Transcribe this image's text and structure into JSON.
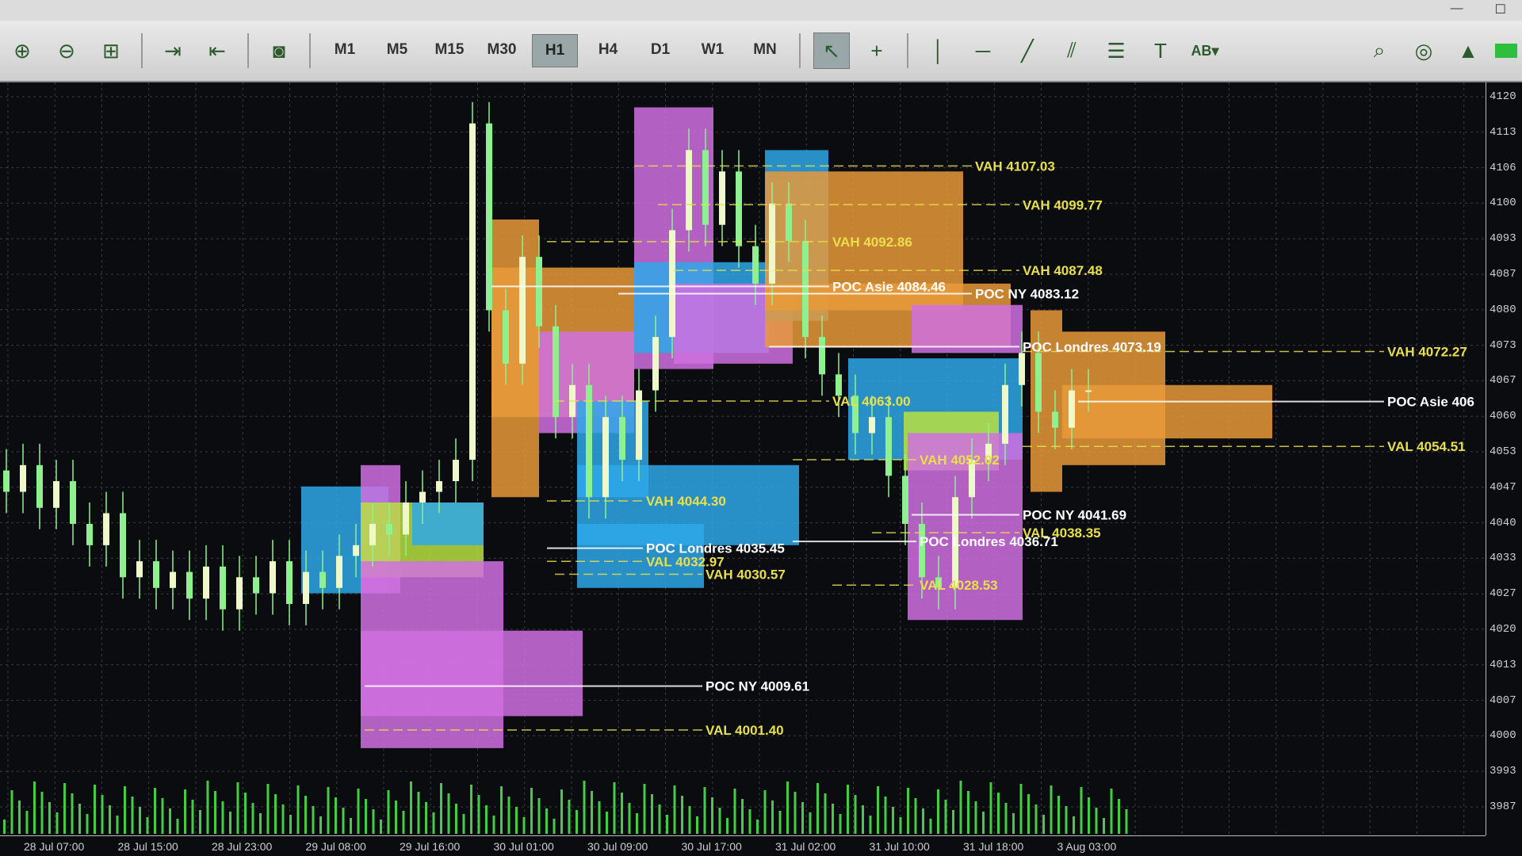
{
  "toolbar": {
    "icons": [
      "zoom-in-icon",
      "zoom-out-icon",
      "grid-icon",
      "autoscroll-icon",
      "chart-shift-icon",
      "screenshot-icon"
    ],
    "timeframes": [
      "M1",
      "M5",
      "M15",
      "M30",
      "H1",
      "H4",
      "D1",
      "W1",
      "MN"
    ],
    "active_timeframe": "H1",
    "tools": [
      "cursor-icon",
      "crosshair-icon",
      "vertical-line-icon",
      "horizontal-line-icon",
      "trendline-icon",
      "channel-icon",
      "fibonacci-icon",
      "text-icon",
      "shapes-icon"
    ],
    "right_icons": [
      "search-icon",
      "profile-icon",
      "signal-icon"
    ],
    "text_tool_glyph": "T",
    "shapes_glyph": "AB"
  },
  "price_axis": [
    "4120",
    "4113",
    "4106",
    "4100",
    "4093",
    "4087",
    "4080",
    "4073",
    "4067",
    "4060",
    "4053",
    "4047",
    "4040",
    "4033",
    "4027",
    "4020",
    "4013",
    "4007",
    "4000",
    "3993",
    "3987"
  ],
  "time_axis": [
    "28 Jul 07:00",
    "28 Jul 15:00",
    "28 Jul 23:00",
    "29 Jul 08:00",
    "29 Jul 16:00",
    "30 Jul 01:00",
    "30 Jul 09:00",
    "30 Jul 17:00",
    "31 Jul 02:00",
    "31 Jul 10:00",
    "31 Jul 18:00",
    "3 Aug 03:00"
  ],
  "levels": [
    {
      "text": "VAH 4107.03",
      "price": 4107.03
    },
    {
      "text": "VAH 4099.77",
      "price": 4099.77
    },
    {
      "text": "VAH 4092.86",
      "price": 4092.86
    },
    {
      "text": "VAH 4087.48",
      "price": 4087.48
    },
    {
      "text": "POC Asie 4084.46",
      "price": 4084.46
    },
    {
      "text": "POC NY 4083.12",
      "price": 4083.12
    },
    {
      "text": "VAH 4072.27",
      "price": 4072.27
    },
    {
      "text": "POC Londres 4073.19",
      "price": 4073.19
    },
    {
      "text": "VAL 4063.00",
      "price": 4063.0
    },
    {
      "text": "POC Asie 406",
      "price": 4062.9
    },
    {
      "text": "VAL 4054.51",
      "price": 4054.51
    },
    {
      "text": "VAH 4052.02",
      "price": 4052.02
    },
    {
      "text": "VAH 4044.30",
      "price": 4044.3
    },
    {
      "text": "POC NY 4041.69",
      "price": 4041.69
    },
    {
      "text": "VAL 4038.35",
      "price": 4038.35
    },
    {
      "text": "POC Londres 4036.71",
      "price": 4036.71
    },
    {
      "text": "POC Londres 4035.45",
      "price": 4035.45
    },
    {
      "text": "VAL 4032.97",
      "price": 4032.97
    },
    {
      "text": "VAH 4030.57",
      "price": 4030.57
    },
    {
      "text": "VAL 4028.53",
      "price": 4028.53
    },
    {
      "text": "POC NY 4009.61",
      "price": 4009.61
    },
    {
      "text": "VAL 4001.40",
      "price": 4001.4
    }
  ],
  "colors": {
    "background": "#0b0c10",
    "grid": "#3a3d44",
    "candle": "#8ff08f",
    "volume": "#44cc44",
    "asia": "#e89a3a",
    "london": "#2ea8e8",
    "ny": "#d070e0",
    "overlap": "#b8e040",
    "poc": "#ffffff",
    "vah_val": "#e8e04a"
  }
}
